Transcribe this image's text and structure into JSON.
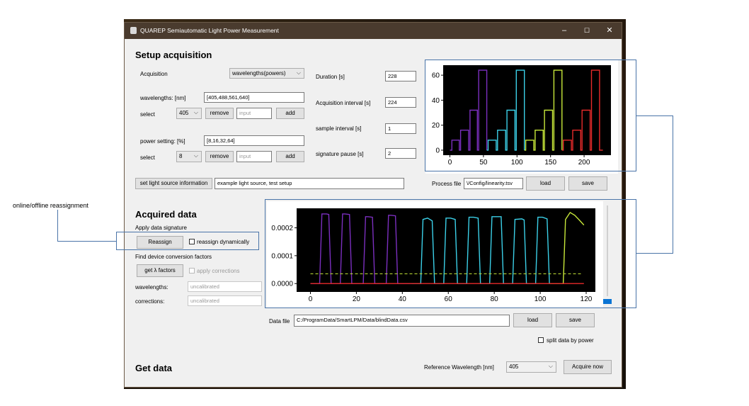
{
  "window": {
    "title": "QUAREP Semiautomatic Light Power Measurement",
    "minimize": "–",
    "maximize": "☐",
    "close": "✕"
  },
  "annotation": {
    "reassignment_label": "online/offline reassignment"
  },
  "setup": {
    "heading": "Setup acquisition",
    "acquisition_label": "Acquisition",
    "acquisition_mode": "wavelengths(powers)",
    "wavelengths_label": "wavelengths: [nm]",
    "wavelengths_value": "[405,488,561,640]",
    "select_label": "select",
    "wl_select": "405",
    "remove_label": "remove",
    "input_placeholder": "input",
    "add_label": "add",
    "power_label": "power setting: [%]",
    "power_value": "[8,16,32,64]",
    "power_select": "8",
    "duration_label": "Duration [s]",
    "duration_value": "228",
    "acq_interval_label": "Acquisition interval [s]",
    "acq_interval_value": "224",
    "sample_interval_label": "sample interval [s]",
    "sample_interval_value": "1",
    "sig_pause_label": "signature pause [s]",
    "sig_pause_value": "2",
    "light_source_button": "set light source information",
    "light_source_value": "example light source, test setup",
    "process_file_label": "Process file",
    "process_file_value": "\\/Config/linearity.tsv",
    "load_label": "load",
    "save_label": "save"
  },
  "acquired": {
    "heading": "Acquired data",
    "apply_sig_label": "Apply data signature",
    "reassign_button": "Reassign",
    "reassign_dyn_label": "reassign dynamically",
    "find_factors_label": "Find device conversion factors",
    "get_factors_button": "get λ factors",
    "apply_corrections_label": "apply corrections",
    "wavelengths_label": "wavelengths:",
    "wavelengths_value": "uncalibrated",
    "corrections_label": "corrections:",
    "corrections_value": "uncalibrated",
    "data_file_label": "Data file",
    "data_file_value": "C:/ProgramData/SmartLPM/Data/blindData.csv",
    "load_label": "load",
    "save_label": "save",
    "split_label": "split data by power",
    "progress": 1.0
  },
  "getdata": {
    "heading": "Get data",
    "ref_wl_label": "Reference Wavelength [nm]",
    "ref_wl_value": "405",
    "acquire_button": "Acquire now"
  },
  "colors": {
    "purple": "#7b2fbf",
    "cyan": "#3bd0e8",
    "yellow": "#c8e83a",
    "red": "#e82a2a",
    "callout": "#4a74a8"
  },
  "chart_data": [
    {
      "type": "line",
      "title": "",
      "xlabel": "",
      "ylabel": "",
      "xlim": [
        -10,
        240
      ],
      "ylim": [
        -4,
        68
      ],
      "xticks": [
        0,
        50,
        100,
        150,
        200
      ],
      "yticks": [
        0,
        20,
        40,
        60
      ],
      "grid": false,
      "background": "#000000",
      "series": [
        {
          "color": "#7b2fbf",
          "x": [
            0,
            3,
            3,
            14,
            14,
            16,
            16,
            28,
            28,
            30,
            30,
            41,
            41,
            43,
            43,
            55,
            55
          ],
          "y": [
            0,
            0,
            8,
            8,
            0,
            0,
            16,
            16,
            0,
            0,
            32,
            32,
            0,
            0,
            64,
            64,
            0
          ]
        },
        {
          "color": "#3bd0e8",
          "x": [
            55,
            57,
            57,
            69,
            69,
            71,
            71,
            83,
            83,
            85,
            85,
            97,
            97,
            99,
            99,
            111,
            111
          ],
          "y": [
            0,
            0,
            8,
            8,
            0,
            0,
            16,
            16,
            0,
            0,
            32,
            32,
            0,
            0,
            64,
            64,
            0
          ]
        },
        {
          "color": "#c8e83a",
          "x": [
            111,
            113,
            113,
            125,
            125,
            127,
            127,
            139,
            139,
            141,
            141,
            153,
            153,
            155,
            155,
            167,
            167
          ],
          "y": [
            0,
            0,
            8,
            8,
            0,
            0,
            16,
            16,
            0,
            0,
            32,
            32,
            0,
            0,
            64,
            64,
            0
          ]
        },
        {
          "color": "#e82a2a",
          "x": [
            167,
            169,
            169,
            181,
            181,
            183,
            183,
            195,
            195,
            197,
            197,
            209,
            209,
            211,
            211,
            223,
            223,
            228
          ],
          "y": [
            0,
            0,
            8,
            8,
            0,
            0,
            16,
            16,
            0,
            0,
            32,
            32,
            0,
            0,
            64,
            64,
            0,
            0
          ]
        }
      ]
    },
    {
      "type": "line",
      "title": "",
      "xlabel": "",
      "ylabel": "",
      "xlim": [
        -6,
        124
      ],
      "ylim": [
        -3e-05,
        0.00027
      ],
      "xticks": [
        0,
        20,
        40,
        60,
        80,
        100,
        120
      ],
      "yticks": [
        "0.0000",
        "0.0001",
        "0.0002"
      ],
      "grid": false,
      "background": "#000000",
      "series": [
        {
          "color": "#7b2fbf",
          "x": [
            0,
            4,
            5,
            7,
            8,
            9,
            13,
            14,
            15,
            17,
            18,
            19,
            23,
            24,
            25,
            27,
            28,
            29,
            33,
            34,
            35,
            37,
            38,
            39,
            43,
            44
          ],
          "y": [
            0,
            0,
            0.00025,
            0.00025,
            0.000248,
            0,
            0,
            0.00025,
            0.00025,
            0.000248,
            0,
            0,
            0,
            0.00024,
            0.00024,
            0.000238,
            0,
            0,
            0,
            0.000245,
            0.000245,
            0.000243,
            0,
            0,
            0,
            0
          ]
        },
        {
          "color": "#3bd0e8",
          "x": [
            44,
            48,
            49,
            51,
            53,
            54,
            58,
            59,
            61,
            63,
            64,
            68,
            69,
            71,
            73,
            74,
            78,
            79,
            81,
            83,
            84,
            88,
            89,
            92,
            93,
            94,
            98,
            99,
            101,
            103,
            104
          ],
          "y": [
            0,
            0,
            0.00023,
            0.000235,
            0.000225,
            0,
            0,
            0.000235,
            0.000235,
            0.00023,
            0,
            0,
            0.000238,
            0.000238,
            0.000235,
            0,
            0,
            0.00024,
            0.00024,
            0.00024,
            0,
            0,
            0.00023,
            0.000232,
            0.000228,
            0,
            0,
            0.000238,
            0.000238,
            0.000232,
            0
          ]
        },
        {
          "color": "#c8e83a",
          "x": [
            104,
            110,
            111,
            113,
            115,
            117,
            119
          ],
          "y": [
            0,
            0,
            0.00023,
            0.000255,
            0.000245,
            0.000228,
            0.00021
          ]
        },
        {
          "color": "#c8e83a",
          "x": [
            0,
            118
          ],
          "y": [
            3.5e-05,
            3.5e-05
          ],
          "dashed": true
        },
        {
          "color": "#e82a2a",
          "x": [
            0,
            119
          ],
          "y": [
            0,
            0
          ]
        }
      ]
    }
  ]
}
